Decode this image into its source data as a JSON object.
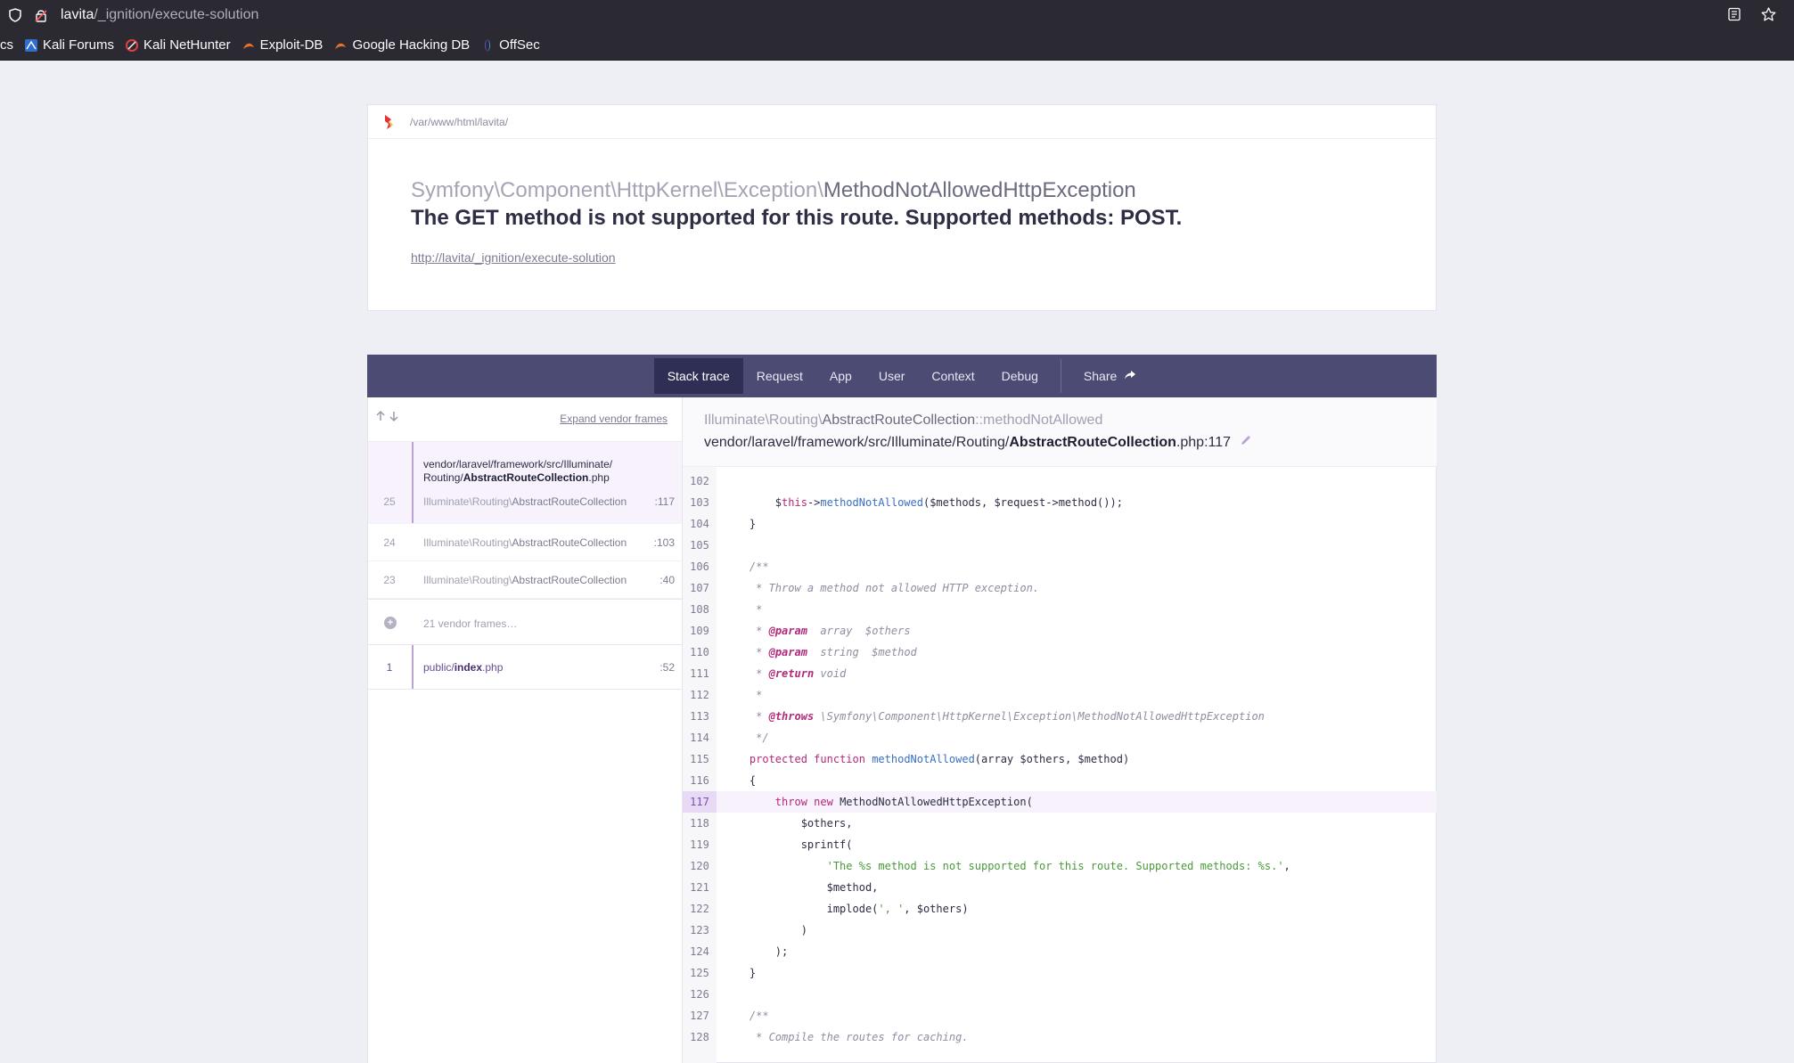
{
  "browser": {
    "url_host": "lavita",
    "url_path": "/_ignition/execute-solution",
    "bookmarks": [
      {
        "label": "cs",
        "icon": "none"
      },
      {
        "label": "Kali Forums",
        "icon": "kali-forums-icon"
      },
      {
        "label": "Kali NetHunter",
        "icon": "nethunter-icon"
      },
      {
        "label": "Exploit-DB",
        "icon": "exploit-db-icon"
      },
      {
        "label": "Google Hacking DB",
        "icon": "ghdb-icon"
      },
      {
        "label": "OffSec",
        "icon": "offsec-icon"
      }
    ]
  },
  "header": {
    "path": "/var/www/html/lavita/",
    "exception_namespace": "Symfony\\Component\\HttpKernel\\Exception\\",
    "exception_class": "MethodNotAllowedHttpException",
    "message": "The GET method is not supported for this route. Supported methods: POST.",
    "url": "http://lavita/_ignition/execute-solution"
  },
  "nav": {
    "tabs": [
      "Stack trace",
      "Request",
      "App",
      "User",
      "Context",
      "Debug"
    ],
    "share_label": "Share",
    "active_tab": "Stack trace"
  },
  "frames": {
    "expand_label": "Expand vendor frames",
    "selected": {
      "num": "25",
      "file_path": "vendor/laravel/framework/src/Illuminate/",
      "file_path2": "Routing/",
      "file_name": "AbstractRouteCollection",
      "file_ext": ".php",
      "ns": "Illuminate\\Routing\\",
      "cls": "AbstractRouteCollection",
      "line": ":117"
    },
    "list": [
      {
        "num": "24",
        "ns": "Illuminate\\Routing\\",
        "cls": "AbstractRouteCollection",
        "line": ":103"
      },
      {
        "num": "23",
        "ns": "Illuminate\\Routing\\",
        "cls": "AbstractRouteCollection",
        "line": ":40"
      }
    ],
    "vendor_label": "21 vendor frames…",
    "app_frame": {
      "num": "1",
      "dir": "public/",
      "name": "index",
      "ext": ".php",
      "line": ":52"
    }
  },
  "code": {
    "method_ns": "Illuminate\\Routing\\",
    "method_cls": "AbstractRouteCollection",
    "method_name": "::methodNotAllowed",
    "file_dir": "vendor/laravel/framework/src/Illuminate/Routing/",
    "file_name": "AbstractRouteCollection",
    "file_ext": ".php:117",
    "highlight_line": 117,
    "lines": [
      {
        "n": "102",
        "html": ""
      },
      {
        "n": "103",
        "html": "        $<span class='t-kw'>this</span>-><span class='t-fn'>methodNotAllowed</span>($methods, $request->method());"
      },
      {
        "n": "104",
        "html": "    }"
      },
      {
        "n": "105",
        "html": ""
      },
      {
        "n": "106",
        "html": "    <span class='t-cm'>/**</span>"
      },
      {
        "n": "107",
        "html": "    <span class='t-cm'> * Throw a method not allowed HTTP exception.</span>"
      },
      {
        "n": "108",
        "html": "    <span class='t-cm'> *</span>"
      },
      {
        "n": "109",
        "html": "    <span class='t-cm'> * </span><span class='t-tag'>@param</span><span class='t-cm'>  array  $others</span>"
      },
      {
        "n": "110",
        "html": "    <span class='t-cm'> * </span><span class='t-tag'>@param</span><span class='t-cm'>  string  $method</span>"
      },
      {
        "n": "111",
        "html": "    <span class='t-cm'> * </span><span class='t-tag'>@return</span><span class='t-cm'> void</span>"
      },
      {
        "n": "112",
        "html": "    <span class='t-cm'> *</span>"
      },
      {
        "n": "113",
        "html": "    <span class='t-cm'> * </span><span class='t-tag'>@throws</span><span class='t-cm'> \\Symfony\\Component\\HttpKernel\\Exception\\MethodNotAllowedHttpException</span>"
      },
      {
        "n": "114",
        "html": "    <span class='t-cm'> */</span>"
      },
      {
        "n": "115",
        "html": "    <span class='t-kw'>protected</span> <span class='t-kw'>function</span> <span class='t-fn'>methodNotAllowed</span>(array $others, $method)"
      },
      {
        "n": "116",
        "html": "    {"
      },
      {
        "n": "117",
        "html": "        <span class='t-kw'>throw</span> <span class='t-kw'>new</span> MethodNotAllowedHttpException("
      },
      {
        "n": "118",
        "html": "            $others,"
      },
      {
        "n": "119",
        "html": "            sprintf("
      },
      {
        "n": "120",
        "html": "                <span class='t-str'>'The %s method is not supported for this route. Supported methods: %s.'</span>,"
      },
      {
        "n": "121",
        "html": "                $method,"
      },
      {
        "n": "122",
        "html": "                implode(<span class='t-str'>', '</span>, $others)"
      },
      {
        "n": "123",
        "html": "            )"
      },
      {
        "n": "124",
        "html": "        );"
      },
      {
        "n": "125",
        "html": "    }"
      },
      {
        "n": "126",
        "html": ""
      },
      {
        "n": "127",
        "html": "    <span class='t-cm'>/**</span>"
      },
      {
        "n": "128",
        "html": "    <span class='t-cm'> * Compile the routes for caching.</span>"
      }
    ]
  },
  "colors": {
    "nav_bg": "#4b4b73",
    "nav_active": "#2f2f55",
    "highlight": "#f7f2fb",
    "page_bg": "#eeeef5"
  }
}
